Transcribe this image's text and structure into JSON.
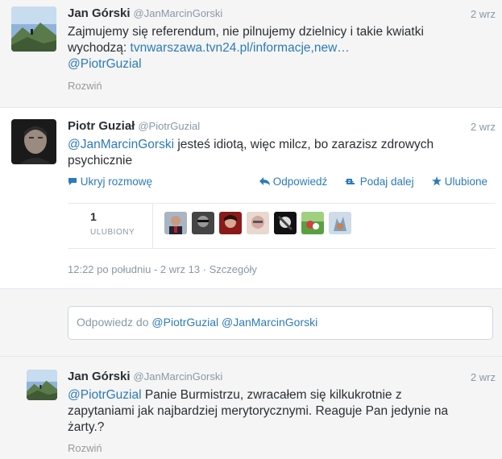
{
  "tweets": [
    {
      "fullname": "Jan Górski",
      "screen_name": "@JanMarcinGorski",
      "time": "2 wrz",
      "text_line1": "Zajmujemy się referendum, nie pilnujemy dzielnicy i takie kwiatki",
      "text_prefix": "wychodzą: ",
      "link": "tvnwarszawa.tvn24.pl/informacje,new…",
      "mention": "@PiotrGuzial",
      "expand": "Rozwiń"
    },
    {
      "fullname": "Piotr Guział",
      "screen_name": "@PiotrGuzial",
      "time": "2 wrz",
      "mention": "@JanMarcinGorski",
      "text_rest": " jesteś idiotą, więc milcz, bo zarazisz zdrowych",
      "text_line2": "psychicznie",
      "actions": {
        "hide": "Ukryj rozmowę",
        "reply": "Odpowiedź",
        "retweet": "Podaj dalej",
        "favorite": "Ulubione"
      },
      "fav_count": "1",
      "fav_label": "ULUBIONY",
      "meta": "12:22 po południu - 2 wrz 13 · Szczegóły"
    },
    {
      "fullname": "Jan Górski",
      "screen_name": "@JanMarcinGorski",
      "time": "2 wrz",
      "mention": "@PiotrGuzial",
      "text_rest": " Panie Burmistrzu, zwracałem się kilkukrotnie z",
      "text_line2": "zapytaniami jak najbardziej merytorycznymi. Reaguje Pan jedynie na",
      "text_line3": "żarty.?",
      "expand": "Rozwiń"
    }
  ],
  "reply_box": {
    "prefix": "Odpowiedz do ",
    "mentions": "@PiotrGuzial @JanMarcinGorski"
  },
  "colors": {
    "link": "#2b7bb9",
    "muted": "#8899a6",
    "text": "#292f33"
  },
  "icons": [
    "chat-bubble-icon",
    "reply-arrow-icon",
    "retweet-icon",
    "star-icon"
  ]
}
